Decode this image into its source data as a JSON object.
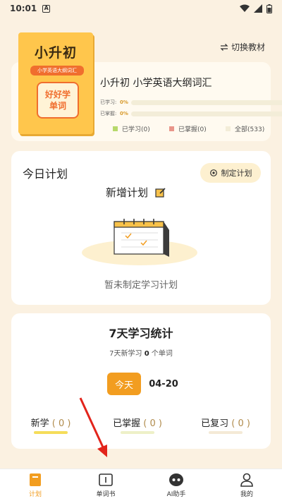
{
  "status_bar": {
    "time": "10:01",
    "badge": "A"
  },
  "header": {
    "switch_label": "切换教材"
  },
  "book": {
    "cover_title": "小升初",
    "cover_subtitle": "小学英语大纲词汇",
    "cover_badge_line1": "好好学",
    "cover_badge_line2": "单词",
    "title": "小升初 小学英语大纲词汇",
    "progress": [
      {
        "label": "已学习:",
        "percent_text": "0%",
        "value": 0
      },
      {
        "label": "已掌握:",
        "percent_text": "0%",
        "value": 0
      }
    ],
    "legend": [
      {
        "label": "已学习(0)",
        "color": "#b7d86b"
      },
      {
        "label": "已掌握(0)",
        "color": "#e9968a"
      },
      {
        "label": "全部(533)",
        "color": "#f3edd8"
      }
    ]
  },
  "plan": {
    "heading": "今日计划",
    "make_plan_label": "制定计划",
    "new_plan_label": "新增计划",
    "empty_text": "暂未制定学习计划"
  },
  "stats": {
    "title": "7天学习统计",
    "sub_prefix": "7天新学习",
    "sub_count": "0",
    "sub_suffix": "个单词",
    "tab_today": "今天",
    "tab_date": "04-20",
    "items": [
      {
        "label": "新学",
        "count": "( 0 )",
        "color": "#f5dd5a"
      },
      {
        "label": "已掌握",
        "count": "( 0 )",
        "color": "#eef0c8"
      },
      {
        "label": "已复习",
        "count": "( 0 )",
        "color": "#f4ead6"
      }
    ]
  },
  "nav": [
    {
      "label": "计划",
      "icon": "plan-icon"
    },
    {
      "label": "单词书",
      "icon": "book-icon"
    },
    {
      "label": "AI助手",
      "icon": "robot-icon"
    },
    {
      "label": "我的",
      "icon": "user-icon"
    }
  ],
  "colors": {
    "accent": "#f29d20",
    "background": "#fbf1e1"
  }
}
